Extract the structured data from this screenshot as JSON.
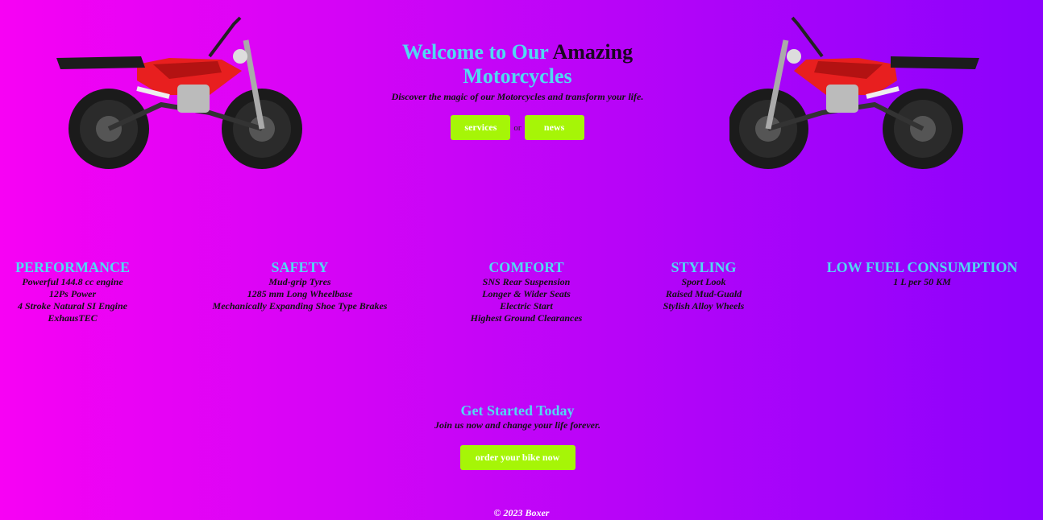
{
  "hero": {
    "title_part1": "Welcome to Our",
    "title_part2": "Amazing",
    "title_part3": "Motorcycles",
    "tagline": "Discover the magic of our Motorcycles and transform your life.",
    "services_label": "services",
    "or_text": "or",
    "news_label": "news"
  },
  "features": [
    {
      "title": "PERFORMANCE",
      "lines": [
        "Powerful 144.8 cc engine",
        "12Ps Power",
        "4 Stroke Natural SI Engine",
        "ExhausTEC"
      ]
    },
    {
      "title": "SAFETY",
      "lines": [
        "Mud-grip Tyres",
        "1285 mm Long Wheelbase",
        "Mechanically Expanding Shoe Type Brakes"
      ]
    },
    {
      "title": "COMFORT",
      "lines": [
        "SNS Rear Suspension",
        "Longer & Wider Seats",
        "Electric Start",
        "Highest Ground Clearances"
      ]
    },
    {
      "title": "STYLING",
      "lines": [
        "Sport Look",
        "Raised Mud-Guald",
        "Stylish Alloy Wheels"
      ]
    },
    {
      "title": "LOW FUEL CONSUMPTION",
      "lines": [
        "1 L per 50 KM"
      ]
    }
  ],
  "cta": {
    "title": "Get Started Today",
    "subtitle": "Join us now and change your life forever.",
    "order_label": "order your bike now"
  },
  "footer": {
    "text": "© 2023 Boxer"
  },
  "images": {
    "left": "motorcycle-red-image",
    "right": "motorcycle-red-image"
  },
  "colors": {
    "accent": "#51d9f2",
    "button": "#a6f507",
    "bg_start": "#f702f4",
    "bg_end": "#8b02fc",
    "bike_red": "#e81f1f"
  }
}
